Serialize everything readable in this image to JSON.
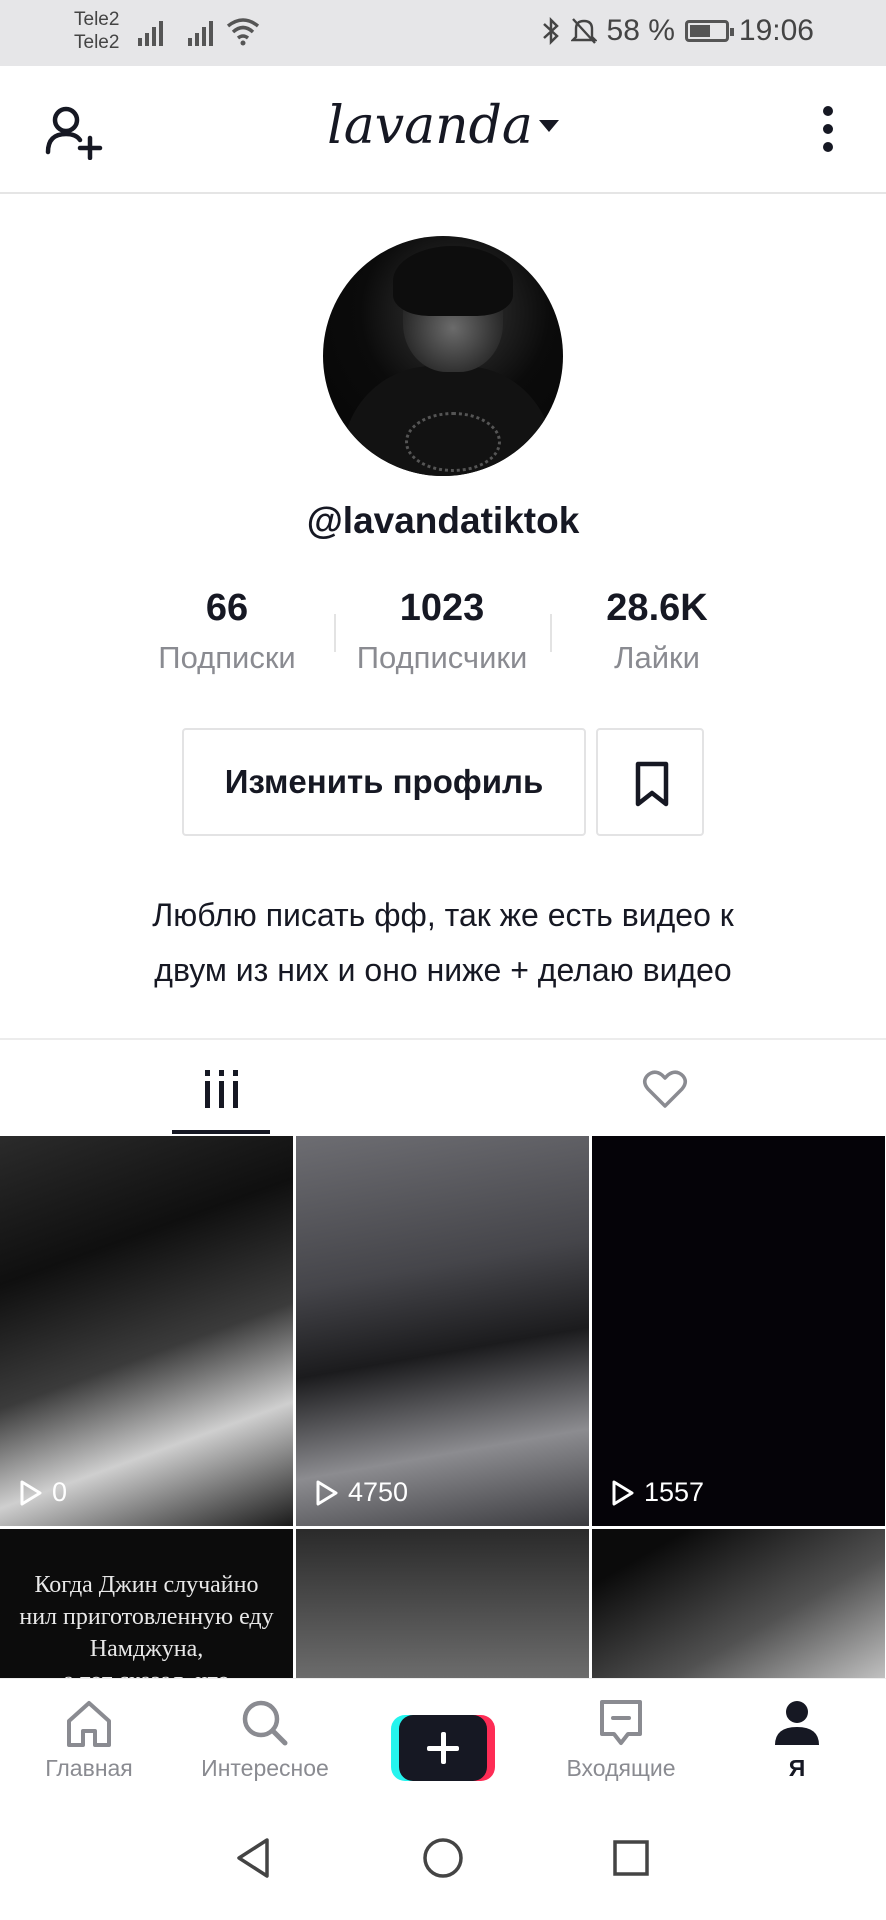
{
  "status_bar": {
    "carrier_1": "Tele2",
    "carrier_2": "Tele2",
    "battery_percent": "58 %",
    "battery_level": 0.58,
    "time": "19:06",
    "icons": [
      "signal-icon",
      "wifi-icon",
      "bluetooth-icon",
      "mute-icon",
      "battery-icon"
    ]
  },
  "header": {
    "title": "lavanda",
    "left_icon": "add-user-icon",
    "right_icon": "more-vertical-icon"
  },
  "profile": {
    "username": "@lavandatiktok",
    "stats": [
      {
        "value": "66",
        "label": "Подписки"
      },
      {
        "value": "1023",
        "label": "Подписчики"
      },
      {
        "value": "28.6K",
        "label": "Лайки"
      }
    ],
    "edit_button": "Изменить профиль",
    "bio_line_1": "Люблю писать фф, так же есть видео к",
    "bio_line_2": "двум из них и оно ниже + делаю видео"
  },
  "tabs": {
    "items": [
      "videos-grid-icon",
      "liked-heart-icon"
    ],
    "active": 0
  },
  "videos": [
    {
      "views": "0"
    },
    {
      "views": "4750"
    },
    {
      "views": "1557"
    },
    {
      "caption_lines": [
        "Когда Джин случайно",
        "нил приготовленную еду",
        "Намджуна,",
        "а тот сказал, что"
      ]
    },
    {},
    {}
  ],
  "bottom_nav": {
    "items": [
      {
        "label": "Главная",
        "icon": "home-icon"
      },
      {
        "label": "Интересное",
        "icon": "search-icon"
      },
      {
        "label": "",
        "icon": "create-plus-icon"
      },
      {
        "label": "Входящие",
        "icon": "inbox-icon"
      },
      {
        "label": "Я",
        "icon": "profile-icon"
      }
    ],
    "active": 4
  },
  "colors": {
    "text_primary": "#161823",
    "text_secondary": "#8a8b91",
    "accent_cyan": "#25f4ee",
    "accent_red": "#fe2c55"
  }
}
